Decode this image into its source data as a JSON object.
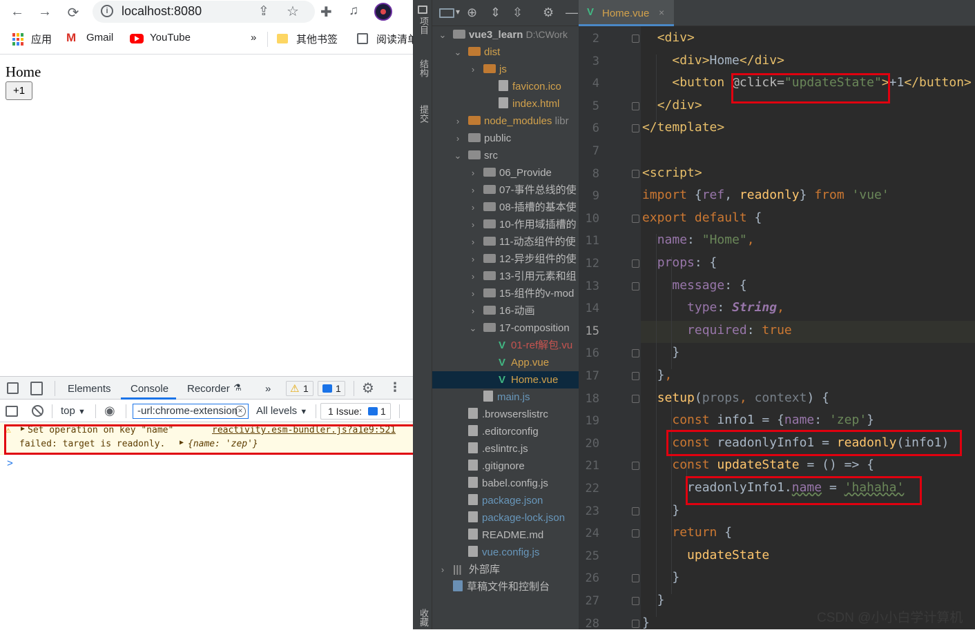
{
  "browser": {
    "url": "localhost:8080",
    "bookmarks": {
      "apps": "应用",
      "gmail": "Gmail",
      "youtube": "YouTube",
      "more": "»",
      "other": "其他书签",
      "reading": "阅读清单"
    },
    "page": {
      "title": "Home",
      "button": "+1"
    }
  },
  "devtools": {
    "tabs": [
      "Elements",
      "Console",
      "Recorder"
    ],
    "more": "»",
    "warn_count": "1",
    "msg_count": "1",
    "context": "top",
    "filter": "-url:chrome-extension",
    "levels": "All levels",
    "issues_label": "1 Issue:",
    "issues_count": "1",
    "warning": {
      "line1": "Set operation on key \"name\"",
      "line2": "failed: target is readonly.",
      "source": "reactivity.esm-bundler.js?a1e9:521",
      "obj": "{name: 'zep'}"
    },
    "prompt": ">"
  },
  "ide": {
    "side_labels": [
      "项目",
      "结构",
      "提交",
      "收藏"
    ],
    "project": {
      "name": "vue3_learn",
      "path": "D:\\CWork"
    },
    "tab": "Home.vue",
    "tree": [
      {
        "label": "dist",
        "type": "folder",
        "indent": 1,
        "arrow": "⌄",
        "color": "#d3a24c"
      },
      {
        "label": "js",
        "type": "folder",
        "indent": 2,
        "arrow": "›",
        "color": "#d3a24c"
      },
      {
        "label": "favicon.ico",
        "type": "file",
        "indent": 3,
        "arrow": "",
        "color": "#d3a24c"
      },
      {
        "label": "index.html",
        "type": "file",
        "indent": 3,
        "arrow": "",
        "color": "#d3a24c"
      },
      {
        "label": "node_modules",
        "type": "folder",
        "indent": 1,
        "arrow": "›",
        "color": "#d3a24c",
        "suffix": "libr"
      },
      {
        "label": "public",
        "type": "folder",
        "indent": 1,
        "arrow": "›",
        "color": "#bbbbbb"
      },
      {
        "label": "src",
        "type": "folder",
        "indent": 1,
        "arrow": "⌄",
        "color": "#bbbbbb"
      },
      {
        "label": "06_Provide",
        "type": "folder",
        "indent": 2,
        "arrow": "›",
        "color": "#bbbbbb"
      },
      {
        "label": "07-事件总线的使",
        "type": "folder",
        "indent": 2,
        "arrow": "›",
        "color": "#bbbbbb"
      },
      {
        "label": "08-插槽的基本使",
        "type": "folder",
        "indent": 2,
        "arrow": "›",
        "color": "#bbbbbb"
      },
      {
        "label": "10-作用域插槽的",
        "type": "folder",
        "indent": 2,
        "arrow": "›",
        "color": "#bbbbbb"
      },
      {
        "label": "11-动态组件的使",
        "type": "folder",
        "indent": 2,
        "arrow": "›",
        "color": "#bbbbbb"
      },
      {
        "label": "12-异步组件的使",
        "type": "folder",
        "indent": 2,
        "arrow": "›",
        "color": "#bbbbbb"
      },
      {
        "label": "13-引用元素和组",
        "type": "folder",
        "indent": 2,
        "arrow": "›",
        "color": "#bbbbbb"
      },
      {
        "label": "15-组件的v-mod",
        "type": "folder",
        "indent": 2,
        "arrow": "›",
        "color": "#bbbbbb"
      },
      {
        "label": "16-动画",
        "type": "folder",
        "indent": 2,
        "arrow": "›",
        "color": "#bbbbbb"
      },
      {
        "label": "17-composition",
        "type": "folder",
        "indent": 2,
        "arrow": "⌄",
        "color": "#bbbbbb"
      },
      {
        "label": "01-ref解包.vu",
        "type": "vue",
        "indent": 3,
        "arrow": "",
        "color": "#c75450"
      },
      {
        "label": "App.vue",
        "type": "vue",
        "indent": 3,
        "arrow": "",
        "color": "#d3a24c"
      },
      {
        "label": "Home.vue",
        "type": "vue",
        "indent": 3,
        "arrow": "",
        "color": "#d3a24c",
        "selected": true
      },
      {
        "label": "main.js",
        "type": "file",
        "indent": 2,
        "arrow": "",
        "color": "#6897bb"
      },
      {
        "label": ".browserslistrc",
        "type": "file",
        "indent": 1,
        "arrow": "",
        "color": "#bbbbbb"
      },
      {
        "label": ".editorconfig",
        "type": "file",
        "indent": 1,
        "arrow": "",
        "color": "#bbbbbb"
      },
      {
        "label": ".eslintrc.js",
        "type": "file",
        "indent": 1,
        "arrow": "",
        "color": "#bbbbbb"
      },
      {
        "label": ".gitignore",
        "type": "file",
        "indent": 1,
        "arrow": "",
        "color": "#bbbbbb"
      },
      {
        "label": "babel.config.js",
        "type": "file",
        "indent": 1,
        "arrow": "",
        "color": "#bbbbbb"
      },
      {
        "label": "package.json",
        "type": "file",
        "indent": 1,
        "arrow": "",
        "color": "#6897bb"
      },
      {
        "label": "package-lock.json",
        "type": "file",
        "indent": 1,
        "arrow": "",
        "color": "#6897bb"
      },
      {
        "label": "README.md",
        "type": "file",
        "indent": 1,
        "arrow": "",
        "color": "#bbbbbb"
      },
      {
        "label": "vue.config.js",
        "type": "file",
        "indent": 1,
        "arrow": "",
        "color": "#6897bb"
      },
      {
        "label": "外部库",
        "type": "lib",
        "indent": 0,
        "arrow": "›",
        "color": "#bbbbbb"
      },
      {
        "label": "草稿文件和控制台",
        "type": "scratch",
        "indent": 0,
        "arrow": "",
        "color": "#bbbbbb"
      }
    ],
    "line_numbers": [
      "2",
      "3",
      "4",
      "5",
      "6",
      "7",
      "8",
      "9",
      "10",
      "11",
      "12",
      "13",
      "14",
      "15",
      "16",
      "17",
      "18",
      "19",
      "20",
      "21",
      "22",
      "23",
      "24",
      "25",
      "26",
      "27",
      "28"
    ],
    "current_line": "15"
  },
  "watermark": "CSDN @小小白学计算机"
}
